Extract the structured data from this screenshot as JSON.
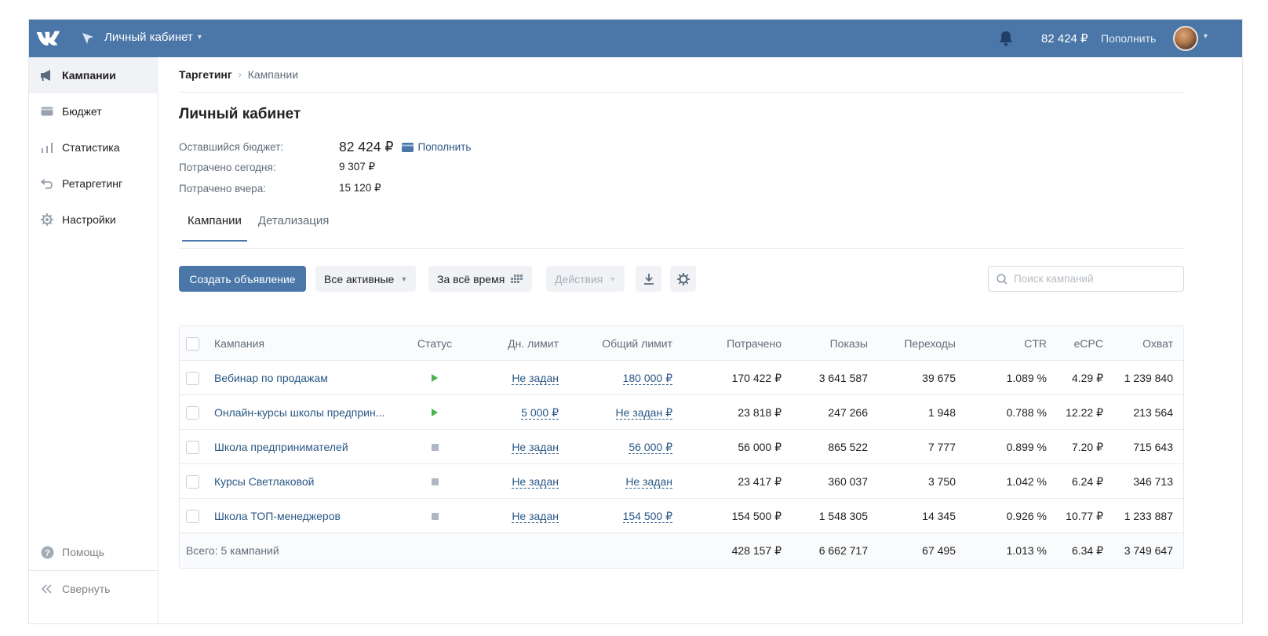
{
  "topbar": {
    "cabinet_title": "Личный кабинет",
    "balance": "82 424 ₽",
    "fill_label": "Пополнить"
  },
  "sidebar": {
    "items": [
      {
        "label": "Кампании",
        "icon": "megaphone-icon",
        "active": true
      },
      {
        "label": "Бюджет",
        "icon": "wallet-icon"
      },
      {
        "label": "Статистика",
        "icon": "bar-chart-icon"
      },
      {
        "label": "Ретаргетинг",
        "icon": "return-arrow-icon"
      },
      {
        "label": "Настройки",
        "icon": "gear-icon"
      }
    ],
    "help_label": "Помощь",
    "collapse_label": "Свернуть"
  },
  "breadcrumb": {
    "root": "Таргетинг",
    "current": "Кампании"
  },
  "page": {
    "title": "Личный кабинет",
    "remaining_label": "Оставшийся бюджет:",
    "remaining_value": "82 424 ₽",
    "fill_link": "Пополнить",
    "spent_today_label": "Потрачено сегодня:",
    "spent_today_value": "9 307 ₽",
    "spent_yesterday_label": "Потрачено вчера:",
    "spent_yesterday_value": "15 120 ₽"
  },
  "tabs": [
    {
      "label": "Кампании",
      "active": true
    },
    {
      "label": "Детализация",
      "active": false
    }
  ],
  "toolbar": {
    "create_label": "Создать объявление",
    "filter_label": "Все активные",
    "period_label": "За всё время",
    "actions_label": "Действия",
    "search_placeholder": "Поиск кампаний"
  },
  "table": {
    "headers": {
      "name": "Кампания",
      "status": "Статус",
      "day_limit": "Дн. лимит",
      "total_limit": "Общий лимит",
      "spent": "Потрачено",
      "shows": "Показы",
      "clicks": "Переходы",
      "ctr": "CTR",
      "ecpc": "eCPC",
      "reach": "Охват"
    },
    "rows": [
      {
        "name": "Вебинар по продажам",
        "status": "running",
        "day_limit": "Не задан",
        "total_limit": "180 000 ₽",
        "spent": "170 422 ₽",
        "shows": "3 641 587",
        "clicks": "39 675",
        "ctr": "1.089 %",
        "ecpc": "4.29 ₽",
        "reach": "1 239 840"
      },
      {
        "name": "Онлайн-курсы школы предприн...",
        "status": "running",
        "day_limit": "5 000 ₽",
        "total_limit": "Не задан ₽",
        "spent": "23 818 ₽",
        "shows": "247 266",
        "clicks": "1 948",
        "ctr": "0.788 %",
        "ecpc": "12.22 ₽",
        "reach": "213 564"
      },
      {
        "name": "Школа предпринимателей",
        "status": "stopped",
        "day_limit": "Не задан",
        "total_limit": "56 000 ₽",
        "spent": "56 000 ₽",
        "shows": "865 522",
        "clicks": "7 777",
        "ctr": "0.899 %",
        "ecpc": "7.20 ₽",
        "reach": "715 643"
      },
      {
        "name": "Курсы Светлаковой",
        "status": "stopped",
        "day_limit": "Не задан",
        "total_limit": "Не задан",
        "spent": "23 417 ₽",
        "shows": "360 037",
        "clicks": "3 750",
        "ctr": "1.042 %",
        "ecpc": "6.24 ₽",
        "reach": "346 713"
      },
      {
        "name": "Школа ТОП-менеджеров",
        "status": "stopped",
        "day_limit": "Не задан",
        "total_limit": "154 500 ₽",
        "spent": "154 500 ₽",
        "shows": "1 548 305",
        "clicks": "14 345",
        "ctr": "0.926 %",
        "ecpc": "10.77 ₽",
        "reach": "1 233 887"
      }
    ],
    "footer": {
      "label": "Всего: 5 кампаний",
      "spent": "428 157 ₽",
      "shows": "6 662 717",
      "clicks": "67 495",
      "ctr": "1.013 %",
      "ecpc": "6.34 ₽",
      "reach": "3 749 647"
    }
  },
  "colors": {
    "brand": "#4a76a8",
    "link": "#2a5885",
    "running": "#4bb34b",
    "stopped": "#aeb7c2"
  }
}
